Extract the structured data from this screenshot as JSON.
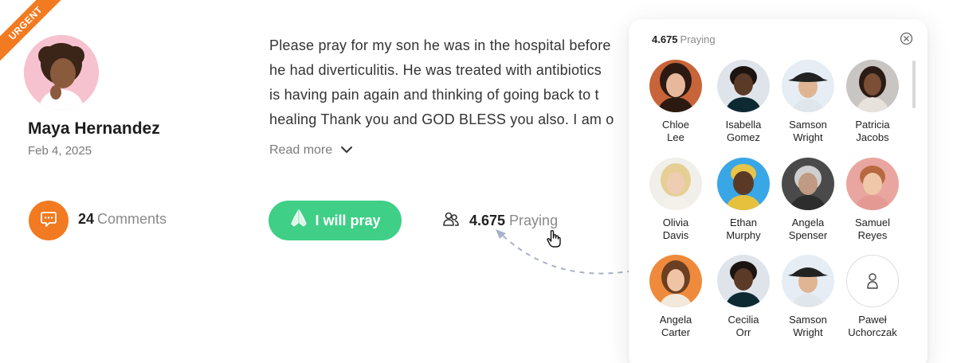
{
  "badge": {
    "label": "URGENT"
  },
  "author": {
    "name": "Maya Hernandez",
    "date": "Feb 4, 2025"
  },
  "post": {
    "lines": [
      "Please pray for my son he was in the hospital before",
      "he had diverticulitis. He was treated with antibiotics",
      "is having pain again and thinking of going back to t",
      "healing Thank you and GOD BLESS you also. I am o"
    ],
    "read_more": "Read more"
  },
  "comments": {
    "count": "24",
    "label": "Comments"
  },
  "pray_button": {
    "label": "I will pray"
  },
  "praying": {
    "count": "4.675",
    "label": "Praying"
  },
  "panel": {
    "count": "4.675",
    "label": "Praying",
    "people": [
      {
        "first": "Chloe",
        "last": "Lee"
      },
      {
        "first": "Isabella",
        "last": "Gomez"
      },
      {
        "first": "Samson",
        "last": "Wright"
      },
      {
        "first": "Patricia",
        "last": "Jacobs"
      },
      {
        "first": "Olivia",
        "last": "Davis"
      },
      {
        "first": "Ethan",
        "last": "Murphy"
      },
      {
        "first": "Angela",
        "last": "Spenser"
      },
      {
        "first": "Samuel",
        "last": "Reyes"
      },
      {
        "first": "Angela",
        "last": "Carter"
      },
      {
        "first": "Cecilia",
        "last": "Orr"
      },
      {
        "first": "Samson",
        "last": "Wright"
      },
      {
        "first": "Paweł",
        "last": "Uchorczak"
      }
    ]
  },
  "colors": {
    "accent_orange": "#f27a21",
    "pray_green": "#3fcf87"
  }
}
